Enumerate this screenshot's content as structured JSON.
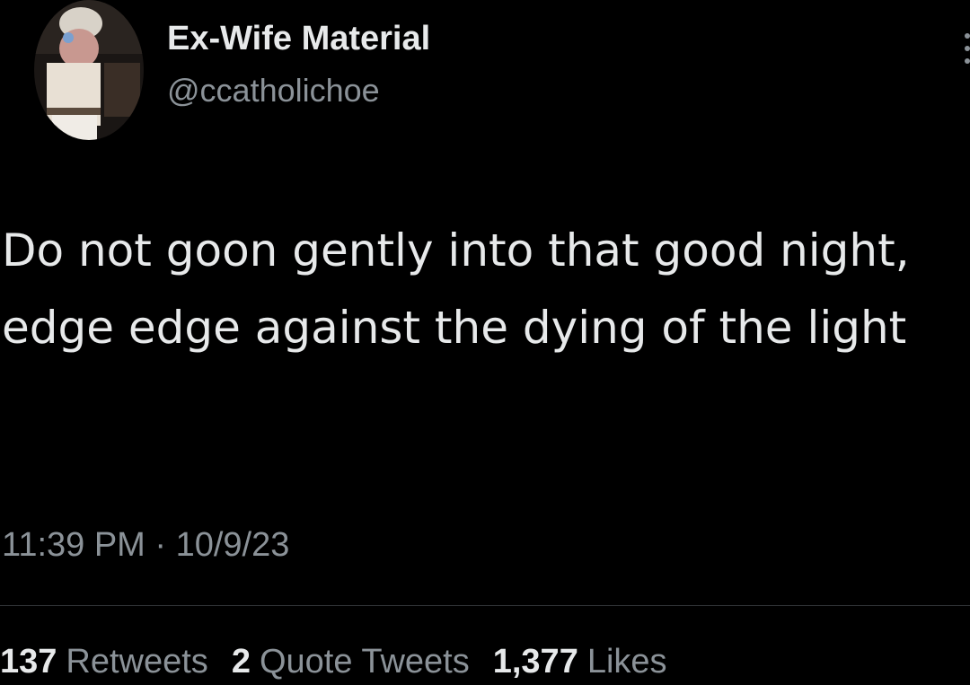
{
  "author": {
    "display_name": "Ex-Wife Material",
    "handle": "@ccatholichoe"
  },
  "tweet": {
    "text": "Do not goon gently into that good night, edge edge against the dying of the light",
    "timestamp": "11:39 PM · 10/9/23"
  },
  "stats": {
    "retweets": {
      "count": "137",
      "label": "Retweets"
    },
    "quote_tweets": {
      "count": "2",
      "label": "Quote Tweets"
    },
    "likes": {
      "count": "1,377",
      "label": "Likes"
    }
  },
  "icons": {
    "more": "more-options-icon",
    "avatar": "profile-avatar"
  },
  "colors": {
    "background": "#000000",
    "primary_text": "#e7e9ea",
    "secondary_text": "#8b9298",
    "divider": "#2f3336"
  }
}
